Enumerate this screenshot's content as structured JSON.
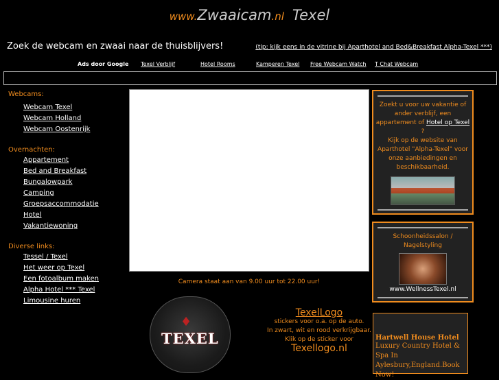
{
  "header": {
    "www": "www.",
    "brand": "Zwaaicam",
    "tld": ".nl",
    "place": "Texel"
  },
  "topbar": {
    "headline": "Zoek de webcam en zwaai naar de thuisblijvers!",
    "tip": "(tip: kijk eens in de vitrine bij Aparthotel and Bed&Breakfast Alpha-Texel ***)"
  },
  "ad_links": [
    "Ads door Google",
    "Texel Verblijf",
    "Hotel Rooms",
    "Kamperen Texel",
    "Free Webcam Watch",
    "T Chat Webcam"
  ],
  "sidebar": {
    "sections": [
      {
        "title": "Webcams:",
        "items": [
          "Webcam Texel",
          "Webcam Holland",
          "Webcam Oostenrijk"
        ]
      },
      {
        "title": "Overnachten:",
        "items": [
          "Appartement",
          "Bed and Breakfast",
          "Bungalowpark",
          "Camping",
          "Groepsaccommodatie",
          "Hotel",
          "Vakantiewoning"
        ]
      },
      {
        "title": "Diverse links:",
        "items": [
          "Tessel / Texel",
          "Het weer op Texel",
          "Een fotoalbum maken",
          "Alpha Hotel *** Texel",
          "Limousine huren"
        ]
      }
    ]
  },
  "webcam": {
    "caption": "Camera staat aan van 9.00 uur tot 22.00 uur!"
  },
  "sticker": {
    "word": "TEXEL"
  },
  "texellogo": {
    "title": "TexelLogo",
    "line1": "stickers voor o.a. op de auto.",
    "line2": "In zwart, wit en rood verkrijgbaar.",
    "line3": "Klik op de sticker voor",
    "site": "Texellogo.nl"
  },
  "box1": {
    "text1": "Zoekt u voor uw vakantie of ander verblijf, een appartement of",
    "link": "Hotel op Texel",
    "text2": "?",
    "text3": "Kijk op de website van Aparthotel \"Alpha-Texel\" voor onze aanbiedingen en beschikbaarheid."
  },
  "box2": {
    "title": "Schoonheidssalon / Nagelstyling",
    "site": "www.WellnessTexel.nl"
  },
  "box3": {
    "heading": "Hartwell House Hotel",
    "body": "Luxury Country Hotel & Spa In Aylesbury,England.Book Now!"
  },
  "colors": {
    "accent": "#f08c1e",
    "background": "#000000",
    "panel": "#222222"
  }
}
